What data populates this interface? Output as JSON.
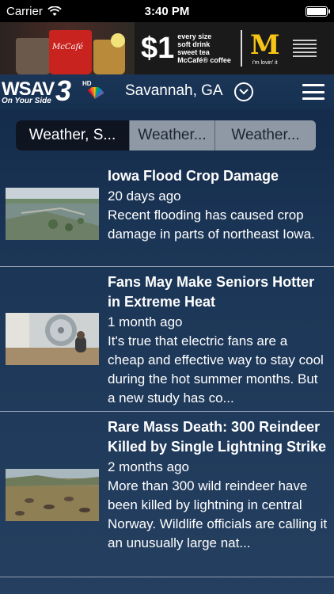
{
  "status_bar": {
    "carrier": "Carrier",
    "time": "3:40 PM",
    "battery_level": 1.0
  },
  "ad": {
    "brand_cups_text": "McCafé",
    "price": "$1",
    "lines": [
      "every size",
      "soft drink",
      "sweet tea",
      "McCafé® coffee"
    ],
    "brand": "M",
    "tagline": "i'm lovin' it"
  },
  "nav": {
    "logo_text": "WSAV",
    "logo_number": "3",
    "logo_hd": "HD",
    "logo_tagline": "On Your Side",
    "location": "Savannah, GA"
  },
  "segments": [
    {
      "label": "Weather, S...",
      "selected": true
    },
    {
      "label": "Weather...",
      "selected": false
    },
    {
      "label": "Weather...",
      "selected": false
    }
  ],
  "articles": [
    {
      "title": "Iowa Flood Crop Damage",
      "date": "20 days ago",
      "summary": "Recent flooding has caused crop damage in parts of northeast Iowa."
    },
    {
      "title": "Fans May Make Seniors Hotter in Extreme Heat",
      "date": "1 month ago",
      "summary": "It's true that electric fans are a cheap and effective way to stay cool during the hot summer months. But a new study has co..."
    },
    {
      "title": "Rare Mass Death:  300 Reindeer Killed by Single Lightning Strike",
      "date": "2 months ago",
      "summary": "More than 300 wild reindeer have been killed by lightning in central Norway. Wildlife officials are calling it an unusually large nat..."
    }
  ],
  "colors": {
    "background": "#1b3556",
    "segment_active": "#0e1420",
    "segment_inactive": "#8f99a6",
    "mcd_yellow": "#f5c518"
  },
  "icons": {
    "wifi": "wifi-icon",
    "battery": "battery-icon",
    "location_chevron": "chevron-down-circle-icon",
    "menu": "hamburger-menu-icon",
    "peacock": "nbc-peacock-icon"
  }
}
